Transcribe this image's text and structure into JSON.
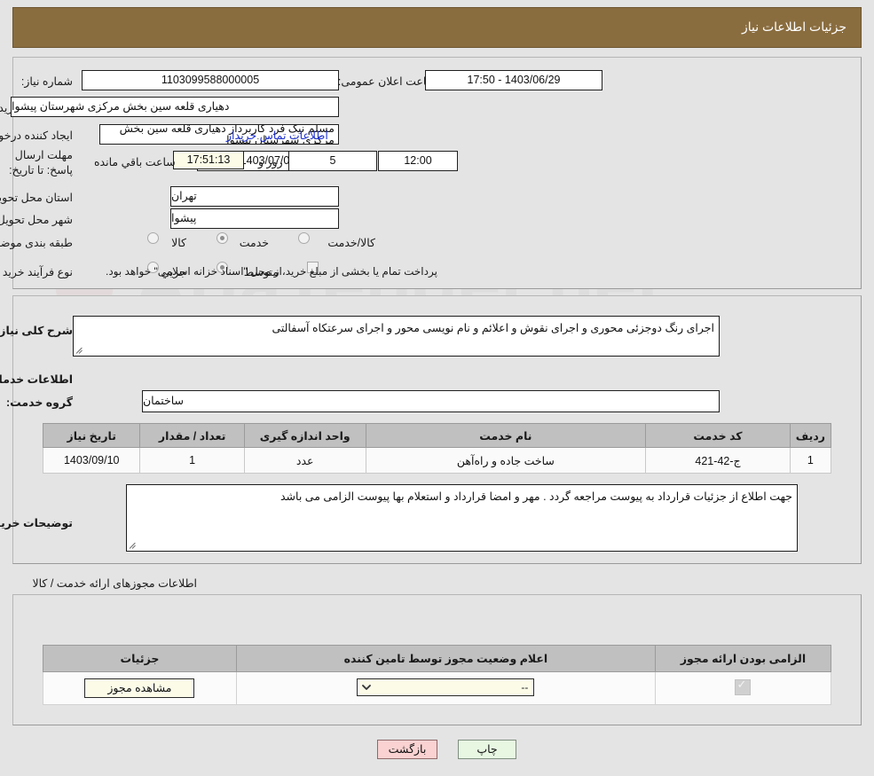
{
  "header": {
    "title": "جزئیات اطلاعات نیاز"
  },
  "fields": {
    "need_number_label": "شماره نیاز:",
    "need_number_value": "1103099588000005",
    "announce_label": "تاریخ و ساعت اعلان عمومی:",
    "announce_value": "1403/06/29 - 17:50",
    "buyer_org_label": "نام دستگاه خریدار:",
    "buyer_org_value": "دهیاری قلعه سین بخش مرکزی شهرستان پیشوا",
    "requester_label": "ایجاد کننده درخواست:",
    "requester_value": "مسلم نیک فرد کاربرداز دهیاری قلعه سین بخش مرکزی شهرستان پیشوا",
    "contact_link": "اطلاعات تماس خریدار",
    "deadline_label": "مهلت ارسال پاسخ: تا تاریخ:",
    "deadline_date": "1403/07/04",
    "hour_label": "ساعت",
    "deadline_time": "12:00",
    "days_value": "5",
    "days_label": "روز و",
    "countdown_value": "17:51:13",
    "countdown_label": "ساعت باقي مانده",
    "province_label": "استان محل تحویل:",
    "province_value": "تهران",
    "city_label": "شهر محل تحویل:",
    "city_value": "پیشوا",
    "category_label": "طبقه بندی موضوعی:",
    "category_options": [
      "کالا",
      "خدمت",
      "کالا/خدمت"
    ],
    "category_selected": "خدمت",
    "process_label": "نوع فرآیند خرید :",
    "process_options": [
      "جزیي",
      "متوسط"
    ],
    "process_selected": "متوسط",
    "treasury_checkbox_label": "پرداخت تمام یا بخشی از مبلغ خرید،از محل \"اسناد خزانه اسلامی\" خواهد بود.",
    "treasury_checked": false
  },
  "description": {
    "label": "شرح کلی نیاز:",
    "value": "اجرای رنگ دوجزئی محوری و اجرای نقوش و اعلائم و نام نویسی محور و اجرای سرعتکاه آسفالتی"
  },
  "services": {
    "section_title": "اطلاعات خدمات مورد نیاز",
    "group_label": "گروه خدمت:",
    "group_value": "ساختمان",
    "columns": [
      "ردیف",
      "کد خدمت",
      "نام خدمت",
      "واحد اندازه گیری",
      "تعداد / مقدار",
      "تاریخ نیاز"
    ],
    "rows": [
      {
        "row": "1",
        "code": "ج-42-421",
        "name": "ساخت جاده و راه‌آهن",
        "unit": "عدد",
        "qty": "1",
        "date": "1403/09/10"
      }
    ]
  },
  "buyer_notes": {
    "label": "توضیحات خریدار:",
    "value": "جهت اطلاع از جزئیات قرارداد به پیوست مراجعه گردد . مهر و امضا قرارداد و استعلام بها پیوست الزامی می باشد"
  },
  "permits": {
    "section_title": "اطلاعات مجوزهای ارائه خدمت / کالا",
    "columns": [
      "الزامی بودن ارائه مجوز",
      "اعلام وضعیت مجوز توسط تامین کننده",
      "جزئیات"
    ],
    "rows": [
      {
        "required_checked": true,
        "status_value": "--",
        "details_button": "مشاهده مجوز"
      }
    ]
  },
  "footer": {
    "back_button": "بازگشت",
    "print_button": "چاپ"
  },
  "colors": {
    "titlebar": "#8a6d3f",
    "link": "#2033d0",
    "back_button_bg": "#fad2d2",
    "print_button_bg": "#e7f7e2",
    "cream_field": "#fbfbe8",
    "table_header": "#c0c0c0"
  }
}
